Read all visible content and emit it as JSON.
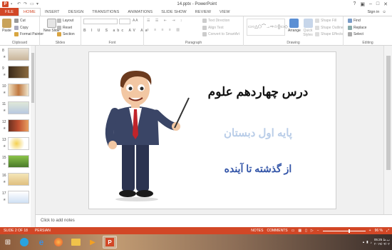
{
  "window": {
    "title": "14.pptx - PowerPoint",
    "sign_in": "Sign in"
  },
  "tabs": [
    "FILE",
    "HOME",
    "INSERT",
    "DESIGN",
    "TRANSITIONS",
    "ANIMATIONS",
    "SLIDE SHOW",
    "REVIEW",
    "VIEW"
  ],
  "ribbon": {
    "clipboard": {
      "label": "Clipboard",
      "paste": "Paste",
      "cut": "Cut",
      "copy": "Copy",
      "format_painter": "Format Painter"
    },
    "slides": {
      "label": "Slides",
      "new_slide": "New Slide",
      "layout": "Layout",
      "reset": "Reset",
      "section": "Section"
    },
    "font": {
      "label": "Font"
    },
    "paragraph": {
      "label": "Paragraph",
      "text_direction": "Text Direction",
      "align_text": "Align Text",
      "convert_smartart": "Convert to SmartArt"
    },
    "drawing": {
      "label": "Drawing",
      "arrange": "Arrange",
      "quick_styles": "Quick Styles",
      "shape_fill": "Shape Fill",
      "shape_outline": "Shape Outline",
      "shape_effects": "Shape Effects"
    },
    "editing": {
      "label": "Editing",
      "find": "Find",
      "replace": "Replace",
      "select": "Select"
    }
  },
  "thumbnails": [
    {
      "num": "8"
    },
    {
      "num": "9"
    },
    {
      "num": "10"
    },
    {
      "num": "11"
    },
    {
      "num": "12"
    },
    {
      "num": "13"
    },
    {
      "num": "15"
    },
    {
      "num": "16"
    },
    {
      "num": "17"
    }
  ],
  "slide": {
    "line1": "درس چهاردهم علوم",
    "line2": "پایه اول دبستان",
    "line3": "از گذشته تا آینده"
  },
  "notes": {
    "placeholder": "Click to add notes"
  },
  "status": {
    "slide_info": "SLIDE 2 OF 18",
    "language": "PERSIAN",
    "notes": "NOTES",
    "comments": "COMMENTS",
    "zoom": "96 %"
  },
  "taskbar": {
    "time": "05:25 ب.ظ",
    "date": "۲۰۱۹/۰۴/۰۲"
  },
  "colors": {
    "accent": "#d24726",
    "title_black": "#111111",
    "subtitle": "#b9cde8",
    "line3": "#3355a8"
  }
}
